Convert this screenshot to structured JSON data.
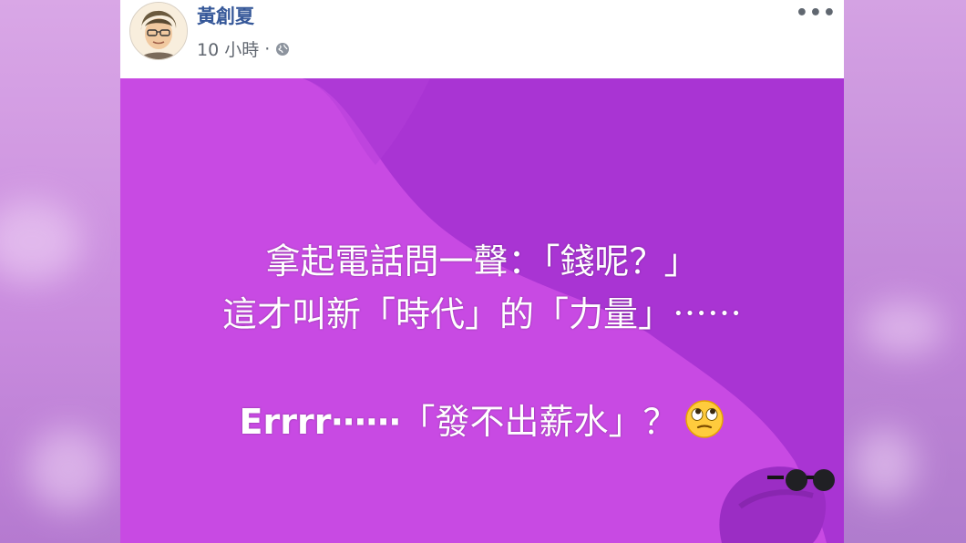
{
  "post": {
    "author": "黃創夏",
    "time": "10 小時",
    "separator": "·",
    "audience_icon": "globe-icon",
    "menu_icon": "more-dots-icon",
    "menu_label": "•••"
  },
  "card": {
    "background_color": "#a934d3",
    "accent_color": "#c84ae3",
    "text_color": "#ffffff",
    "line1": "拿起電話問一聲：「錢呢？」",
    "line2": "這才叫新「時代」的「力量」⋯⋯",
    "line3_prefix": "Errrr⋯⋯",
    "line3_rest": "「發不出薪水」？",
    "emoji": "face-with-rolling-eyes-icon"
  }
}
